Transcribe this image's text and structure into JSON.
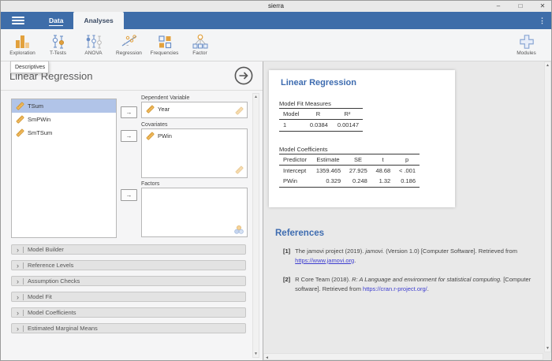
{
  "colors": {
    "ribbon_blue": "#3e6da9",
    "accent_orange": "#e2a13d",
    "heading_blue": "#3e6cb0",
    "selection_blue": "#b1c4e8",
    "link_blue": "#3d3dd0"
  },
  "window": {
    "title": "sierra"
  },
  "window_controls": {
    "minimize": "–",
    "maximize": "□",
    "close": "✕"
  },
  "icons": {
    "menu_dots": "⋮",
    "chevron": "›",
    "move_arrow": "→",
    "scroll_up": "▲",
    "scroll_down": "▼",
    "scroll_left": "◄"
  },
  "ribbon": {
    "tabs": [
      {
        "label": "Data"
      },
      {
        "label": "Analyses"
      }
    ]
  },
  "toolbar": {
    "buttons": [
      {
        "label": "Exploration"
      },
      {
        "label": "T-Tests"
      },
      {
        "label": "ANOVA"
      },
      {
        "label": "Regression"
      },
      {
        "label": "Frequencies"
      },
      {
        "label": "Factor"
      }
    ],
    "modules_label": "Modules"
  },
  "menu_popup": {
    "items": [
      {
        "label": "Descriptives"
      }
    ]
  },
  "options": {
    "title": "Linear Regression",
    "variables": [
      {
        "name": "TSum"
      },
      {
        "name": "SmPWin"
      },
      {
        "name": "SmTSum"
      }
    ],
    "dependent": {
      "label": "Dependent Variable",
      "value": "Year"
    },
    "covariates": {
      "label": "Covariates",
      "value": "PWin"
    },
    "factors": {
      "label": "Factors"
    },
    "sections": [
      {
        "label": "Model Builder"
      },
      {
        "label": "Reference Levels"
      },
      {
        "label": "Assumption Checks"
      },
      {
        "label": "Model Fit"
      },
      {
        "label": "Model Coefficients"
      },
      {
        "label": "Estimated Marginal Means"
      }
    ]
  },
  "results": {
    "title": "Linear Regression",
    "model_fit": {
      "caption": "Model Fit Measures",
      "columns": [
        "Model",
        "R",
        "R²"
      ],
      "rows": [
        [
          "1",
          "0.0384",
          "0.00147"
        ]
      ]
    },
    "coefficients": {
      "caption": "Model Coefficients",
      "columns": [
        "Predictor",
        "Estimate",
        "SE",
        "t",
        "p"
      ],
      "rows": [
        [
          "Intercept",
          "1359.465",
          "27.925",
          "48.68",
          "< .001"
        ],
        [
          "PWin",
          "0.329",
          "0.248",
          "1.32",
          "0.186"
        ]
      ]
    },
    "references": {
      "title": "References",
      "items": [
        {
          "index": "[1]",
          "pre": "The jamovi project (2019). ",
          "italic": "jamovi.",
          "post": " (Version 1.0) [Computer Software]. Retrieved from ",
          "link": "https://www.jamovi.org",
          "suffix": "."
        },
        {
          "index": "[2]",
          "pre": "R Core Team (2018). ",
          "italic": "R: A Language and environment for statistical computing.",
          "post": " [Computer software]. Retrieved from ",
          "link": "https://cran.r-project.org/",
          "suffix": "."
        }
      ]
    }
  }
}
